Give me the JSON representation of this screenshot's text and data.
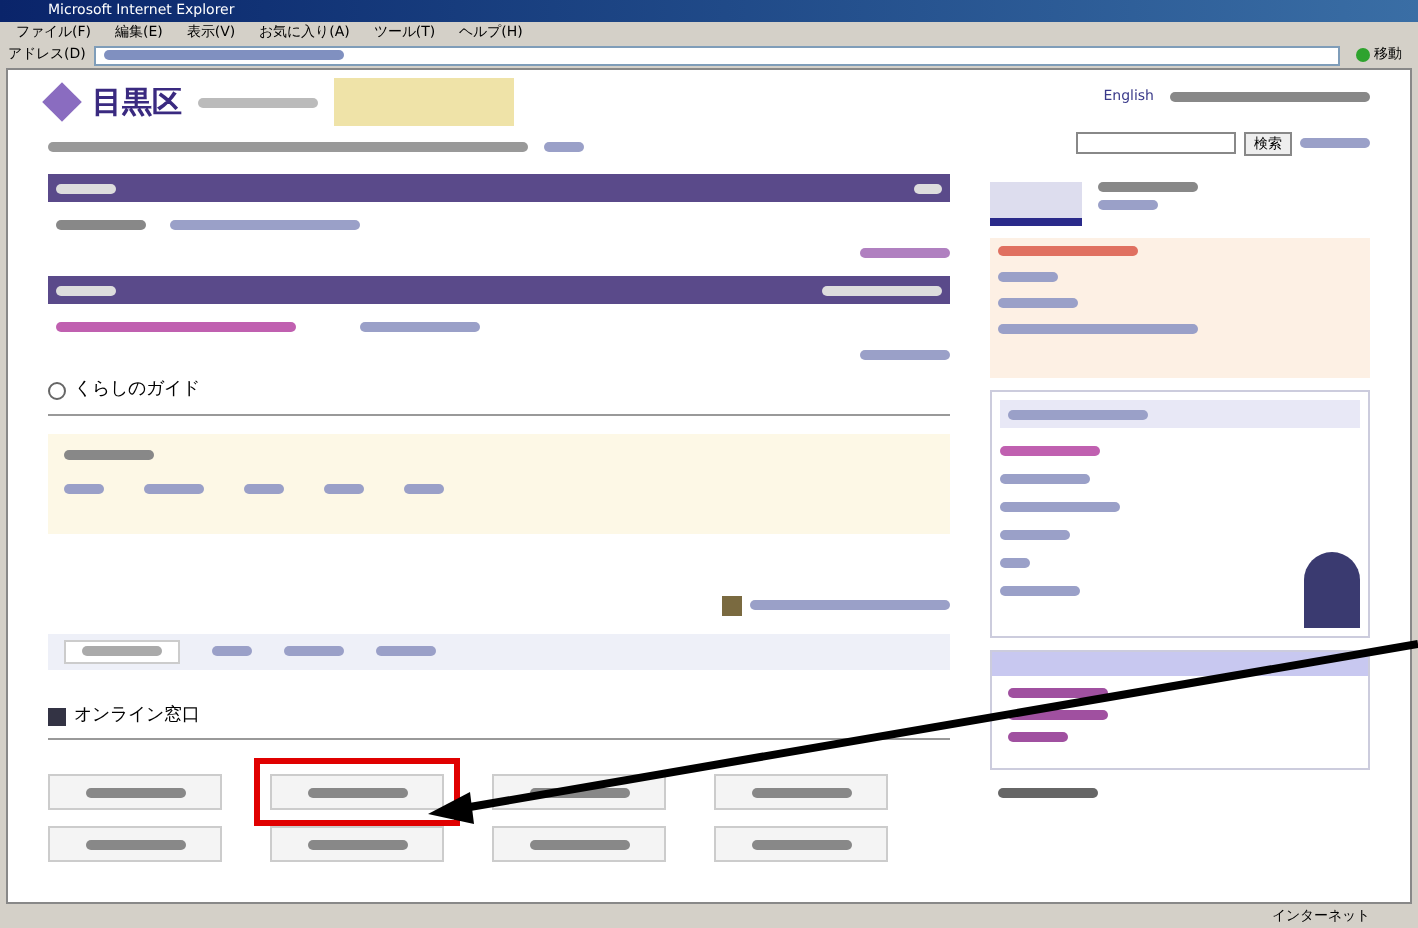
{
  "window": {
    "title": "Microsoft Internet Explorer"
  },
  "menu": [
    "ファイル(F)",
    "編集(E)",
    "表示(V)",
    "お気に入り(A)",
    "ツール(T)",
    "ヘルプ(H)"
  ],
  "address_bar": {
    "label": "アドレス(D)",
    "go": "移動"
  },
  "site": {
    "logo": "目黒区",
    "language_link": "English",
    "search_button": "検索"
  },
  "guide": {
    "title": "くらしのガイド"
  },
  "online": {
    "title": "オンライン窓口",
    "buttons": [
      {
        "highlighted": false
      },
      {
        "highlighted": true
      },
      {
        "highlighted": false
      },
      {
        "highlighted": false
      },
      {
        "highlighted": false
      },
      {
        "highlighted": false
      },
      {
        "highlighted": false
      },
      {
        "highlighted": false
      }
    ]
  },
  "status_bar": {
    "zone": "インターネット"
  }
}
